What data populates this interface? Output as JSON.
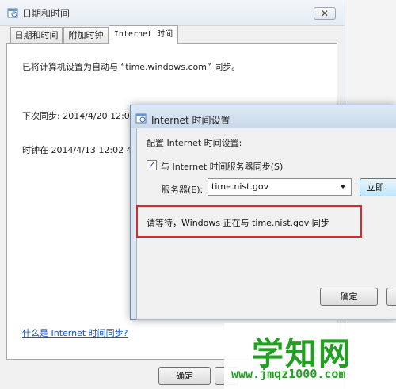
{
  "main_window": {
    "title": "日期和时间",
    "close_glyph": "✕",
    "tabs": [
      {
        "label": "日期和时间"
      },
      {
        "label": "附加时钟"
      },
      {
        "label": "Internet 时间"
      }
    ],
    "sync_text": "已将计算机设置为自动与 “time.windows.com” 同步。",
    "next_sync": "下次同步: 2014/4/20 12:0",
    "clock_text": "时钟在 2014/4/13 12:02 4",
    "help_link": "什么是 Internet 时间同步?",
    "ok_label": "确定"
  },
  "dialog": {
    "title": "Internet 时间设置",
    "config_label": "配置 Internet 时间设置:",
    "sync_checkbox_label": "与 Internet 时间服务器同步(S)",
    "sync_checked": true,
    "check_glyph": "✓",
    "server_label": "服务器(E):",
    "server_value": "time.nist.gov",
    "update_now_label": "立即",
    "status_text": "请等待，Windows 正在与 time.nist.gov 同步",
    "ok_label": "确定"
  },
  "watermark": {
    "brand": "学知网",
    "url": "www.jmqz1000.com"
  },
  "colors": {
    "highlight_border": "#d42b2b",
    "watermark_green": "#22a022",
    "link_blue": "#1155cc"
  },
  "icons": [
    "date-time-icon",
    "close-icon",
    "date-time-icon",
    "dropdown-arrow-icon",
    "checkmark-icon"
  ]
}
